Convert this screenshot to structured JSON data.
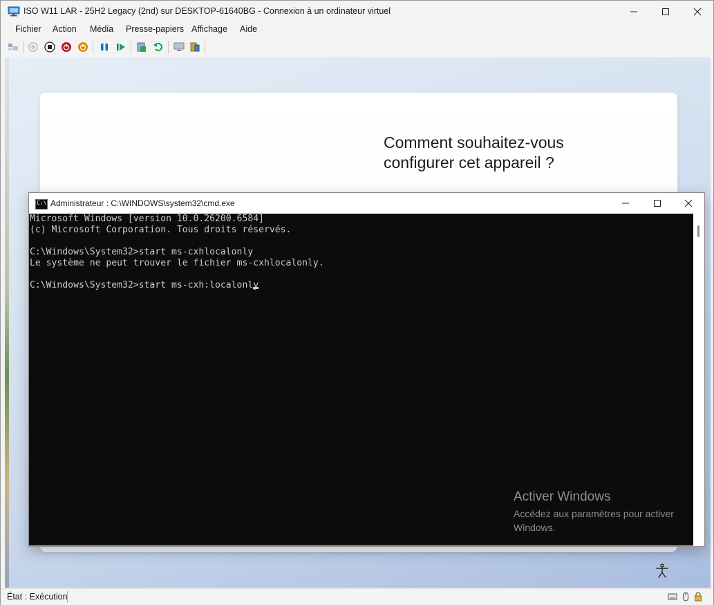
{
  "window": {
    "title": "ISO W11 LAR - 25H2 Legacy (2nd) sur DESKTOP-61640BG - Connexion à un ordinateur virtuel"
  },
  "menu": [
    "Fichier",
    "Action",
    "Média",
    "Presse-papiers",
    "Affichage",
    "Aide"
  ],
  "toolbar": [
    {
      "name": "ctrl-alt-del-icon"
    },
    {
      "name": "start-icon"
    },
    {
      "name": "turn-off-icon"
    },
    {
      "name": "shut-down-icon"
    },
    {
      "name": "save-icon"
    },
    {
      "name": "pause-icon"
    },
    {
      "name": "resume-icon"
    },
    {
      "name": "checkpoint-icon"
    },
    {
      "name": "revert-icon"
    },
    {
      "name": "enhanced-session-icon"
    },
    {
      "name": "share-icon"
    }
  ],
  "oobe": {
    "title": "Comment souhaitez-vous configurer cet appareil ?"
  },
  "cmd": {
    "title": "Administrateur : C:\\WINDOWS\\system32\\cmd.exe",
    "lines": [
      "Microsoft Windows [version 10.0.26200.6584]",
      "(c) Microsoft Corporation. Tous droits réservés.",
      "",
      "C:\\Windows\\System32>start ms-cxhlocalonly",
      "Le système ne peut trouver le fichier ms-cxhlocalonly.",
      "",
      "C:\\Windows\\System32>start ms-cxh:localonly"
    ]
  },
  "watermark": {
    "heading": "Activer Windows",
    "text": "Accédez aux paramètres pour activer Windows."
  },
  "status": {
    "text": "État : Exécution"
  },
  "colors": {
    "console_bg": "#0c0c0c",
    "console_fg": "#cccccc",
    "pause_blue": "#0078d4",
    "resume_green": "#16a34a",
    "shutdown_red": "#c50f1f",
    "save_orange": "#e08a00"
  }
}
